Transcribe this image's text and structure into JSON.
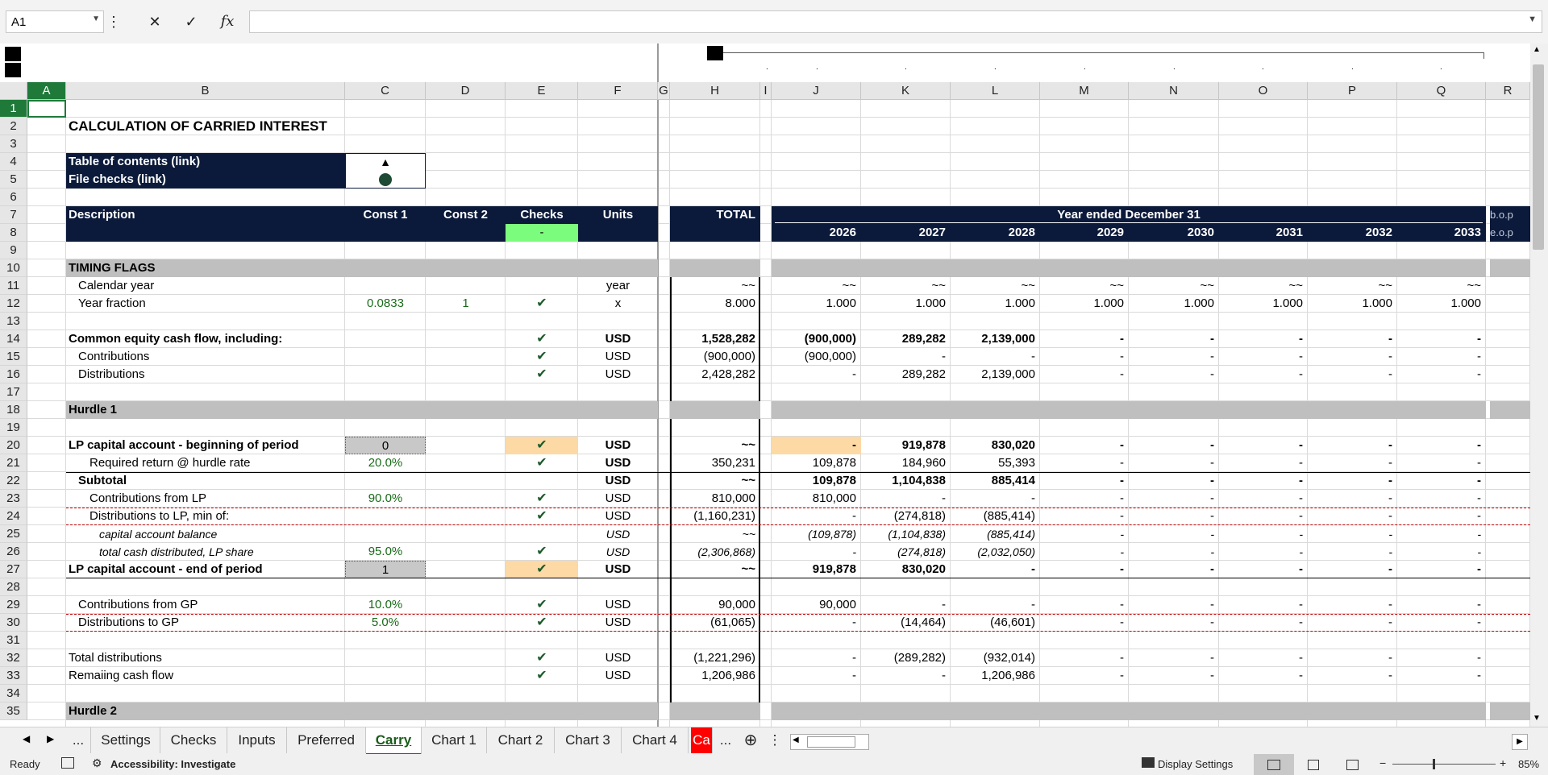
{
  "formula_bar": {
    "name_box": "A1",
    "formula": ""
  },
  "columns": [
    "A",
    "B",
    "C",
    "D",
    "E",
    "F",
    "G",
    "H",
    "I",
    "J",
    "K",
    "L",
    "M",
    "N",
    "O",
    "P",
    "Q",
    "R"
  ],
  "rows": [
    "1",
    "2",
    "3",
    "4",
    "5",
    "6",
    "7",
    "8",
    "9",
    "10",
    "11",
    "12",
    "13",
    "14",
    "15",
    "16",
    "17",
    "18",
    "19",
    "20",
    "21",
    "22",
    "23",
    "24",
    "25",
    "26",
    "27",
    "28",
    "29",
    "30",
    "31",
    "32",
    "33",
    "34",
    "35"
  ],
  "sheet": {
    "title": "CALCULATION OF CARRIED INTEREST",
    "toc_label": "Table of contents (link)",
    "toc_icon": "▲",
    "filechecks_label": "File checks (link)",
    "header": {
      "description": "Description",
      "const1": "Const 1",
      "const2": "Const 2",
      "checks": "Checks",
      "checks_value": "-",
      "units": "Units",
      "total": "TOTAL",
      "year_ended": "Year ended December 31",
      "years": [
        "2026",
        "2027",
        "2028",
        "2029",
        "2030",
        "2031",
        "2032",
        "2033"
      ],
      "bop": "b.o.p",
      "eop": "e.o.p"
    },
    "sections": {
      "timing": "TIMING FLAGS",
      "hurdle1": "Hurdle 1",
      "hurdle2": "Hurdle 2"
    },
    "lines": {
      "r11": {
        "label": "Calendar year",
        "units": "year",
        "total": "~~",
        "vals": [
          "~~",
          "~~",
          "~~",
          "~~",
          "~~",
          "~~",
          "~~",
          "~~"
        ]
      },
      "r12": {
        "label": "Year fraction",
        "c": "0.0833",
        "d": "1",
        "check": "✔",
        "units": "x",
        "total": "8.000",
        "vals": [
          "1.000",
          "1.000",
          "1.000",
          "1.000",
          "1.000",
          "1.000",
          "1.000",
          "1.000"
        ]
      },
      "r14": {
        "label": "Common equity cash flow, including:",
        "check": "✔",
        "units": "USD",
        "total": "1,528,282",
        "vals": [
          "(900,000)",
          "289,282",
          "2,139,000",
          "-",
          "-",
          "-",
          "-",
          "-"
        ]
      },
      "r15": {
        "label": "Contributions",
        "check": "✔",
        "units": "USD",
        "total": "(900,000)",
        "vals": [
          "(900,000)",
          "-",
          "-",
          "-",
          "-",
          "-",
          "-",
          "-"
        ]
      },
      "r16": {
        "label": "Distributions",
        "check": "✔",
        "units": "USD",
        "total": "2,428,282",
        "vals": [
          "-",
          "289,282",
          "2,139,000",
          "-",
          "-",
          "-",
          "-",
          "-"
        ]
      },
      "r20": {
        "label": "LP capital account - beginning of period",
        "c": "0",
        "check": "✔",
        "units": "USD",
        "total": "~~",
        "vals": [
          "-",
          "919,878",
          "830,020",
          "-",
          "-",
          "-",
          "-",
          "-"
        ]
      },
      "r21": {
        "label": "Required return @ hurdle rate",
        "c": "20.0%",
        "check": "✔",
        "units": "USD",
        "total": "350,231",
        "vals": [
          "109,878",
          "184,960",
          "55,393",
          "-",
          "-",
          "-",
          "-",
          "-"
        ]
      },
      "r22": {
        "label": "Subtotal",
        "units": "USD",
        "total": "~~",
        "vals": [
          "109,878",
          "1,104,838",
          "885,414",
          "-",
          "-",
          "-",
          "-",
          "-"
        ]
      },
      "r23": {
        "label": "Contributions from LP",
        "c": "90.0%",
        "check": "✔",
        "units": "USD",
        "total": "810,000",
        "vals": [
          "810,000",
          "-",
          "-",
          "-",
          "-",
          "-",
          "-",
          "-"
        ]
      },
      "r24": {
        "label": "Distributions to LP, min of:",
        "check": "✔",
        "units": "USD",
        "total": "(1,160,231)",
        "vals": [
          "-",
          "(274,818)",
          "(885,414)",
          "-",
          "-",
          "-",
          "-",
          "-"
        ]
      },
      "r25": {
        "label": "capital account balance",
        "units": "USD",
        "total": "~~",
        "vals": [
          "(109,878)",
          "(1,104,838)",
          "(885,414)",
          "-",
          "-",
          "-",
          "-",
          "-"
        ]
      },
      "r26": {
        "label": "total cash distributed, LP share",
        "c": "95.0%",
        "check": "✔",
        "units": "USD",
        "total": "(2,306,868)",
        "vals": [
          "-",
          "(274,818)",
          "(2,032,050)",
          "-",
          "-",
          "-",
          "-",
          "-"
        ]
      },
      "r27": {
        "label": "LP capital account - end of period",
        "c": "1",
        "check": "✔",
        "units": "USD",
        "total": "~~",
        "vals": [
          "919,878",
          "830,020",
          "-",
          "-",
          "-",
          "-",
          "-",
          "-"
        ]
      },
      "r29": {
        "label": "Contributions from GP",
        "c": "10.0%",
        "check": "✔",
        "units": "USD",
        "total": "90,000",
        "vals": [
          "90,000",
          "-",
          "-",
          "-",
          "-",
          "-",
          "-",
          "-"
        ]
      },
      "r30": {
        "label": "Distributions to GP",
        "c": "5.0%",
        "check": "✔",
        "units": "USD",
        "total": "(61,065)",
        "vals": [
          "-",
          "(14,464)",
          "(46,601)",
          "-",
          "-",
          "-",
          "-",
          "-"
        ]
      },
      "r32": {
        "label": "Total distributions",
        "check": "✔",
        "units": "USD",
        "total": "(1,221,296)",
        "vals": [
          "-",
          "(289,282)",
          "(932,014)",
          "-",
          "-",
          "-",
          "-",
          "-"
        ]
      },
      "r33": {
        "label": "Remaiing cash flow",
        "check": "✔",
        "units": "USD",
        "total": "1,206,986",
        "vals": [
          "-",
          "-",
          "1,206,986",
          "-",
          "-",
          "-",
          "-",
          "-"
        ]
      }
    }
  },
  "tabs": {
    "ellipsis_left": "...",
    "items": [
      "Settings",
      "Checks",
      "Inputs",
      "Preferred",
      "Carry",
      "Chart 1",
      "Chart 2",
      "Chart 3",
      "Chart 4",
      "Ca"
    ],
    "active": "Carry",
    "ellipsis_right": "...",
    "add": "⊕"
  },
  "status": {
    "ready": "Ready",
    "accessibility": "Accessibility: Investigate",
    "display_settings": "Display Settings",
    "zoom": "85%"
  }
}
